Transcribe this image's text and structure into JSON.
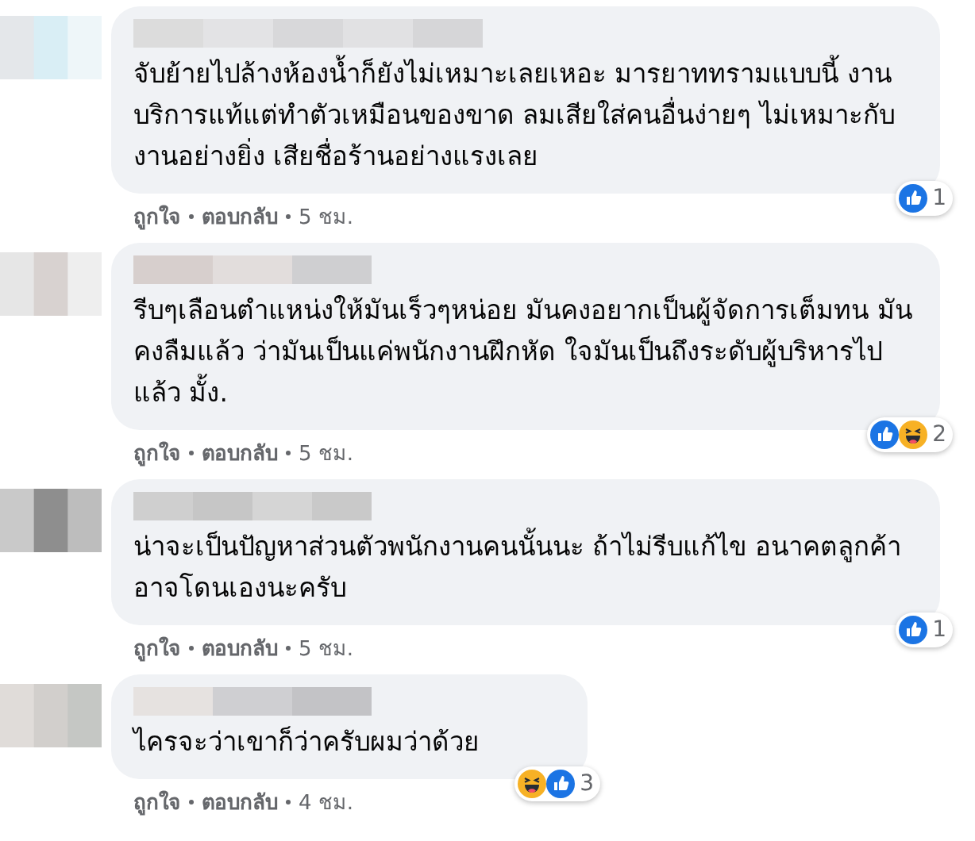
{
  "comments": [
    {
      "text": "จับย้ายไปล้างห้องน้ำก็ยังไม่เหมาะเลยเหอะ มารยาททรามแบบนี้ งานบริการแท้แต่ทำตัวเหมือนของขาด ลมเสียใส่คนอื่นง่ายๆ ไม่เหมาะกับงานอย่างยิ่ง เสียชื่อร้านอย่างแรงเลย",
      "reactions": [
        {
          "kind": "like"
        }
      ],
      "count": "1",
      "actions": [
        "ถูกใจ",
        "ตอบกลับ"
      ],
      "time": "5 ชม."
    },
    {
      "text": "รีบๆเลือนตำแหน่งให้มันเร็วๆหน่อย มันคงอยากเป็นผู้จัดการเต็มทน มันคงลืมแล้ว ว่ามันเป็นแค่พนักงานฝึกหัด ใจมันเป็นถึงระดับผู้บริหารไปแล้ว มั้ง.",
      "reactions": [
        {
          "kind": "like"
        },
        {
          "kind": "haha"
        }
      ],
      "count": "2",
      "actions": [
        "ถูกใจ",
        "ตอบกลับ"
      ],
      "time": "5 ชม."
    },
    {
      "text": "น่าจะเป็นปัญหาส่วนตัวพนักงานคนนั้นนะ ถ้าไม่รีบแก้ไข อนาคตลูกค้าอาจโดนเองนะครับ",
      "reactions": [
        {
          "kind": "like"
        }
      ],
      "count": "1",
      "actions": [
        "ถูกใจ",
        "ตอบกลับ"
      ],
      "time": "5 ชม."
    },
    {
      "text": "ไครจะว่าเขาก็ว่าครับผมว่าด้วย",
      "reactions": [
        {
          "kind": "haha"
        },
        {
          "kind": "like"
        }
      ],
      "count": "3",
      "actions": [
        "ถูกใจ",
        "ตอบกลับ"
      ],
      "time": "4 ชม."
    }
  ]
}
